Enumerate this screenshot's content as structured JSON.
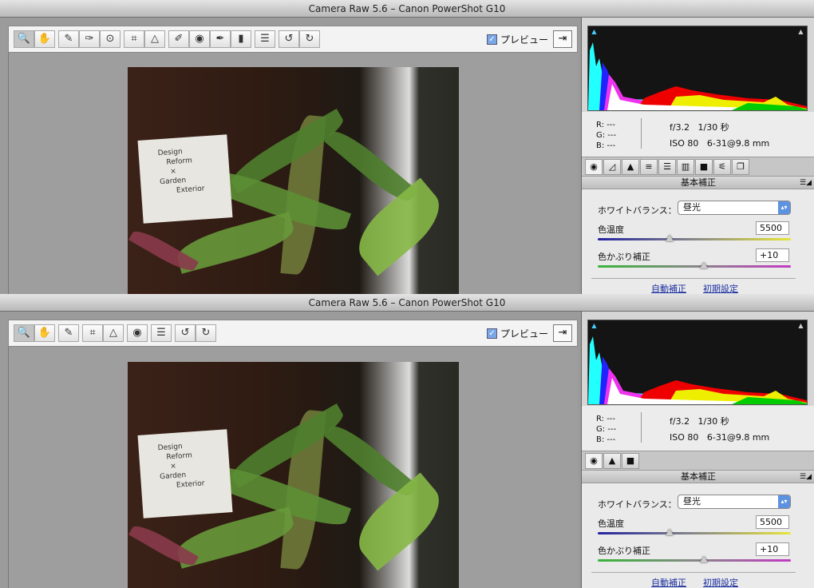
{
  "windows": [
    {
      "title": "Camera Raw 5.6  –  Canon PowerShot G10",
      "tools": [
        {
          "name": "zoom-tool",
          "glyph": "🔍",
          "sel": true
        },
        {
          "name": "hand-tool",
          "glyph": "✋"
        },
        {
          "name": "white-balance-tool",
          "glyph": "✎",
          "gap": true
        },
        {
          "name": "color-sampler-tool",
          "glyph": "✑"
        },
        {
          "name": "targeted-adjustment-tool",
          "glyph": "⊙"
        },
        {
          "name": "crop-tool",
          "glyph": "⌗",
          "gap": true
        },
        {
          "name": "straighten-tool",
          "glyph": "△"
        },
        {
          "name": "spot-removal-tool",
          "glyph": "✐",
          "gap": true
        },
        {
          "name": "red-eye-tool",
          "glyph": "◉"
        },
        {
          "name": "adjustment-brush-tool",
          "glyph": "✒"
        },
        {
          "name": "graduated-filter-tool",
          "glyph": "▮"
        },
        {
          "name": "preferences-button",
          "glyph": "☰",
          "gap": true
        },
        {
          "name": "rotate-left-button",
          "glyph": "↺",
          "gap": true
        },
        {
          "name": "rotate-right-button",
          "glyph": "↻"
        }
      ],
      "panel_tabs": [
        "◉",
        "◿",
        "▲",
        "≡",
        "☰",
        "▥",
        "■",
        "⚟",
        "❐"
      ]
    },
    {
      "title": "Camera Raw 5.6  –  Canon PowerShot G10",
      "tools": [
        {
          "name": "zoom-tool",
          "glyph": "🔍",
          "sel": true
        },
        {
          "name": "hand-tool",
          "glyph": "✋"
        },
        {
          "name": "white-balance-tool",
          "glyph": "✎",
          "gap": true
        },
        {
          "name": "crop-tool",
          "glyph": "⌗",
          "gap": true
        },
        {
          "name": "straighten-tool",
          "glyph": "△"
        },
        {
          "name": "red-eye-tool",
          "glyph": "◉",
          "gap": true
        },
        {
          "name": "preferences-button",
          "glyph": "☰",
          "gap": true
        },
        {
          "name": "rotate-left-button",
          "glyph": "↺",
          "gap": true
        },
        {
          "name": "rotate-right-button",
          "glyph": "↻"
        }
      ],
      "panel_tabs": [
        "◉",
        "▲",
        "■"
      ]
    }
  ],
  "preview_label": "プレビュー",
  "sign": [
    "Design",
    "Reform",
    "×",
    "Garden",
    "Exterior"
  ],
  "info": {
    "r": "R:  ---",
    "g": "G:  ---",
    "b": "B:  ---",
    "exif1": "f/3.2   1/30 秒",
    "exif2": "ISO 80   6-31@9.8 mm"
  },
  "panel": {
    "header": "基本補正",
    "wb_label": "ホワイトバランス：",
    "wb_value": "昼光",
    "temp_label": "色温度",
    "temp_value": "5500",
    "temp_fraction": 0.37,
    "tint_label": "色かぶり補正",
    "tint_value": "+10",
    "tint_fraction": 0.55,
    "auto": "自動補正",
    "default": "初期設定"
  },
  "colors": {
    "accent": "#5c92e0",
    "link": "#1a2fa0"
  }
}
